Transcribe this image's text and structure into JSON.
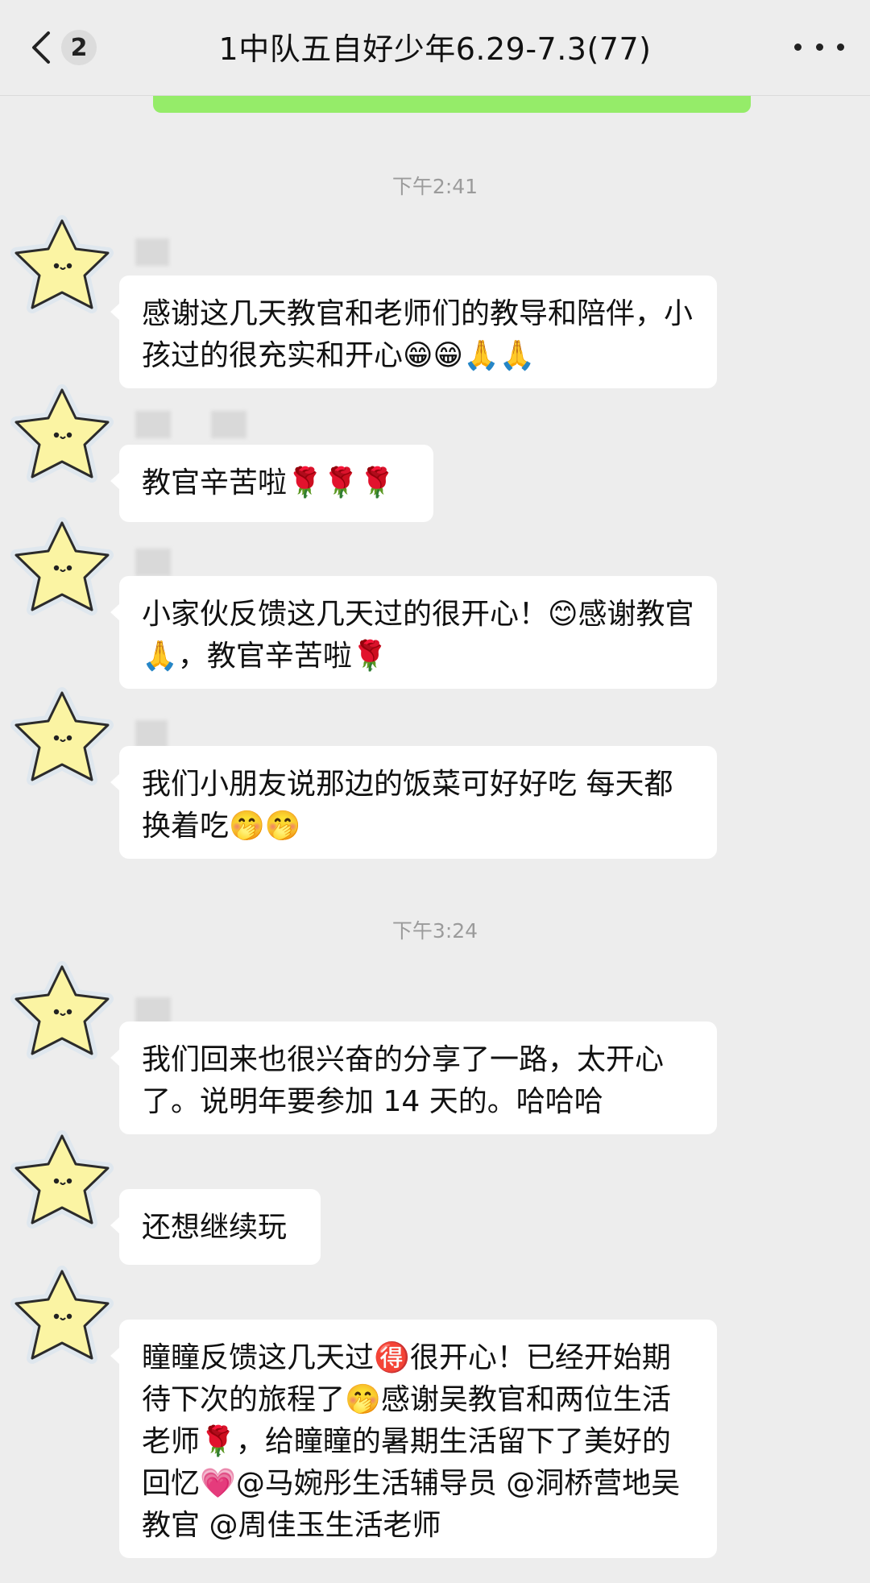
{
  "header": {
    "back_count": "2",
    "title": "1中队五自好少年6.29-7.3(77)"
  },
  "messages": [
    {
      "time": "下午2:41",
      "text": "感谢这几天教官和老师们的教导和陪伴，小孩过的很充实和开心😁😁🙏🙏"
    },
    {
      "text": "教官辛苦啦🌹🌹🌹"
    },
    {
      "text": "小家伙反馈这几天过的很开心！😊感谢教官🙏，教官辛苦啦🌹"
    },
    {
      "text": "我们小朋友说那边的饭菜可好好吃 每天都换着吃🤭🤭"
    },
    {
      "time": "下午3:24",
      "text": "我们回来也很兴奋的分享了一路，太开心了。说明年要参加 14 天的。哈哈哈"
    },
    {
      "text": "还想继续玩"
    },
    {
      "text": "瞳瞳反馈这几天过🉐很开心！已经开始期待下次的旅程了🤭感谢吴教官和两位生活老师🌹，给瞳瞳的暑期生活留下了美好的回忆💗@马婉彤生活辅导员 @洞桥营地吴教官 @周佳玉生活老师"
    }
  ],
  "icons": {
    "back": "chevron-left-icon",
    "more": "more-dots-icon",
    "avatar": "star-face-avatar"
  },
  "colors": {
    "background": "#ededed",
    "bubble": "#ffffff",
    "green": "#95ec69"
  }
}
